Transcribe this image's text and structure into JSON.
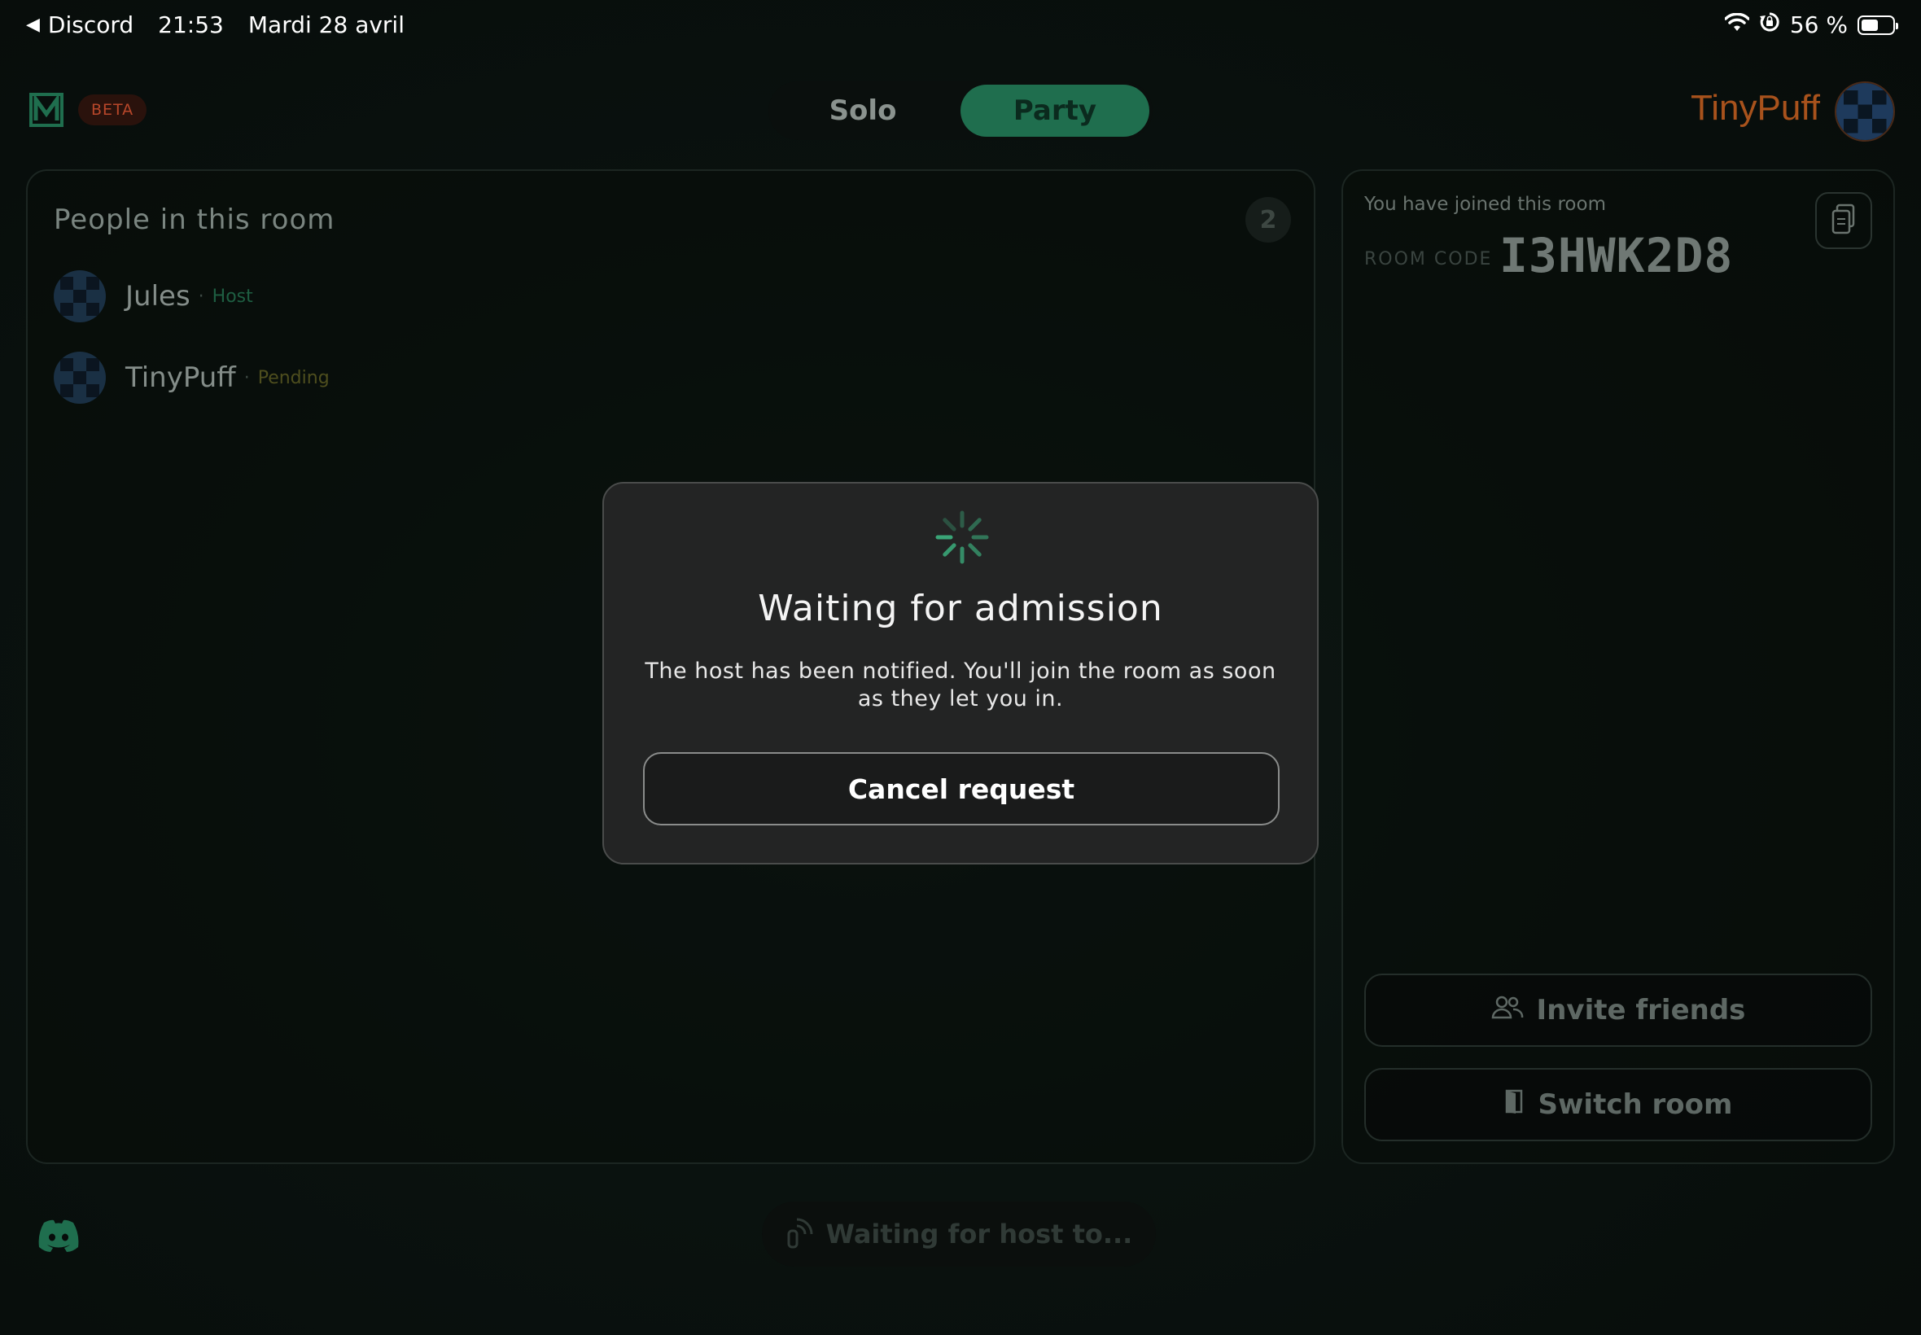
{
  "status_bar": {
    "back_app": "Discord",
    "time": "21:53",
    "date": "Mardi 28 avril",
    "battery": "56 %",
    "battery_level": 0.56
  },
  "header": {
    "beta_label": "BETA",
    "modes": [
      "Solo",
      "Party"
    ],
    "active_mode": "Party",
    "username": "TinyPuff"
  },
  "people_panel": {
    "title": "People in this room",
    "count": "2",
    "people": [
      {
        "name": "Jules",
        "role": "Host"
      },
      {
        "name": "TinyPuff",
        "role": "Pending"
      }
    ]
  },
  "room_panel": {
    "joined_text": "You have joined this room",
    "code_label": "ROOM CODE",
    "code": "I3HWK2D8",
    "invite_label": "Invite friends",
    "switch_label": "Switch room"
  },
  "footer": {
    "waiting_label": "Waiting for host to..."
  },
  "dialog": {
    "title": "Waiting for admission",
    "body": "The host has been notified. You'll join the room as soon as they let you in.",
    "cancel_label": "Cancel request"
  },
  "colors": {
    "accent_green": "#1f6e4e",
    "username_orange": "#a8521c",
    "spinner_green": "#3aa577"
  },
  "icons": [
    "back-arrow-icon",
    "wifi-icon",
    "orientation-lock-icon",
    "battery-icon",
    "logo-icon",
    "copy-icon",
    "users-icon",
    "door-icon",
    "discord-icon",
    "broadcast-icon",
    "spinner-icon"
  ]
}
